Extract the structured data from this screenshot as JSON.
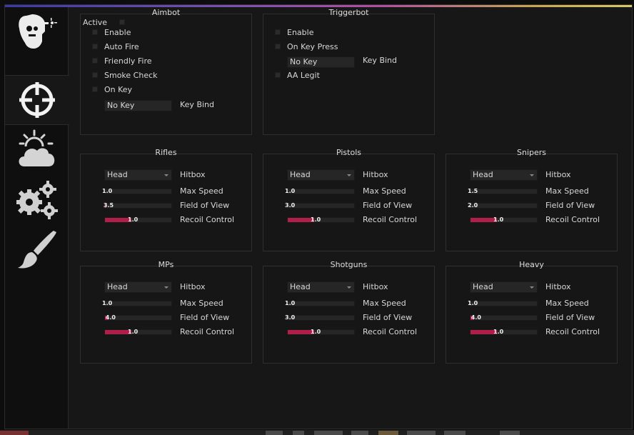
{
  "sidebar": {
    "tabs": [
      {
        "name": "visuals-head-icon",
        "active": false
      },
      {
        "name": "crosshair-icon",
        "active": true
      },
      {
        "name": "weather-cloud-icon",
        "active": false
      },
      {
        "name": "gears-icon",
        "active": false
      },
      {
        "name": "paint-brush-icon",
        "active": false
      }
    ]
  },
  "aimbot": {
    "title": "Aimbot",
    "active_label": "Active",
    "options": [
      "Enable",
      "Auto Fire",
      "Friendly Fire",
      "Smoke Check",
      "On Key"
    ],
    "key_value": "No Key",
    "key_bind_label": "Key Bind"
  },
  "triggerbot": {
    "title": "Triggerbot",
    "options": [
      "Enable",
      "On Key Press"
    ],
    "key_value": "No Key",
    "key_bind_label": "Key Bind",
    "aa_legit_label": "AA Legit"
  },
  "labels": {
    "hitbox": "Hitbox",
    "max_speed": "Max Speed",
    "fov": "Field of View",
    "recoil": "Recoil Control"
  },
  "accent_color": "#b01f4a",
  "weapons": [
    {
      "title": "Rifles",
      "hitbox": "Head",
      "max_speed": "1.0",
      "max_speed_fill": 0.0,
      "fov": "3.5",
      "fov_fill": 0.02,
      "recoil": "1.0",
      "recoil_fill": 0.4
    },
    {
      "title": "Pistols",
      "hitbox": "Head",
      "max_speed": "1.0",
      "max_speed_fill": 0.0,
      "fov": "3.0",
      "fov_fill": 0.0,
      "recoil": "1.0",
      "recoil_fill": 0.4
    },
    {
      "title": "Snipers",
      "hitbox": "Head",
      "max_speed": "1.5",
      "max_speed_fill": 0.0,
      "fov": "2.0",
      "fov_fill": 0.0,
      "recoil": "1.0",
      "recoil_fill": 0.4
    },
    {
      "title": "MPs",
      "hitbox": "Head",
      "max_speed": "1.0",
      "max_speed_fill": 0.0,
      "fov": "4.0",
      "fov_fill": 0.05,
      "recoil": "1.0",
      "recoil_fill": 0.4
    },
    {
      "title": "Shotguns",
      "hitbox": "Head",
      "max_speed": "1.0",
      "max_speed_fill": 0.0,
      "fov": "3.0",
      "fov_fill": 0.0,
      "recoil": "1.0",
      "recoil_fill": 0.4
    },
    {
      "title": "Heavy",
      "hitbox": "Head",
      "max_speed": "1.0",
      "max_speed_fill": 0.0,
      "fov": "4.0",
      "fov_fill": 0.05,
      "recoil": "1.0",
      "recoil_fill": 0.4
    }
  ]
}
